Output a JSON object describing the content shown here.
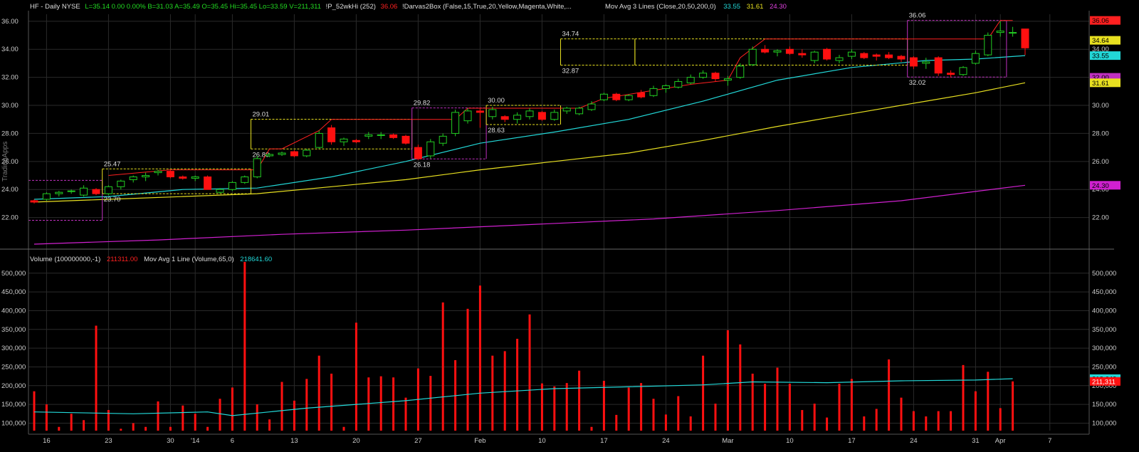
{
  "header": {
    "symbol_line": "HF - Daily  NYSE",
    "quote": "L=35.14  0.00  0.00%   B=31.03  A=35.49  O=35.45  Hi=35.45  Lo=33.59  V=211,311",
    "indicator_52wk": "!P_52wkHi (252)",
    "indicator_52wk_value": "36.06",
    "darvas": "!Darvas2Box (False,15,True,20,Yellow,Magenta,White,...",
    "mov_avg_label": "Mov Avg 3 Lines (Close,20,50,200,0)",
    "ma20_value": "33.55",
    "ma50_value": "31.61",
    "ma200_value": "24.30"
  },
  "volume_header": {
    "label": "Volume (100000000,-1)",
    "value": "211311.00",
    "ma_label": "Mov Avg 1 Line (Volume,65,0)",
    "ma_value": "218641.60"
  },
  "watermark": "TradingApps",
  "colors": {
    "up": "#22cc22",
    "down": "#ff1010",
    "ma20": "#22d8d8",
    "ma50": "#e8e020",
    "ma200": "#d020d0",
    "box_yellow": "#e8e020",
    "box_magenta": "#c030c0",
    "hi52": "#ff2020",
    "volume_bar": "#ff1010",
    "volume_ma": "#22d8d8"
  },
  "price_axis": {
    "ticks": [
      "36.00",
      "34.00",
      "32.00",
      "30.00",
      "28.00",
      "26.00",
      "24.00",
      "22.00"
    ],
    "tick_values": [
      36,
      34,
      32,
      30,
      28,
      26,
      24,
      22
    ],
    "ylim": [
      20,
      36.5
    ]
  },
  "volume_axis": {
    "ticks": [
      "500,000",
      "450,000",
      "400,000",
      "350,000",
      "300,000",
      "250,000",
      "200,000",
      "150,000",
      "100,000"
    ],
    "tick_values": [
      500000,
      450000,
      400000,
      350000,
      300000,
      250000,
      200000,
      150000,
      100000
    ],
    "ylim": [
      80000,
      530000
    ]
  },
  "x_axis": {
    "labels": [
      "16",
      "23",
      "30",
      "'14",
      "6",
      "13",
      "20",
      "27",
      "Feb",
      "10",
      "17",
      "24",
      "Mar",
      "10",
      "17",
      "24",
      "31",
      "Apr",
      "7"
    ],
    "label_slots": [
      1,
      6,
      11,
      13,
      16,
      21,
      26,
      31,
      36,
      41,
      46,
      51,
      56,
      61,
      66,
      71,
      76,
      78,
      82
    ]
  },
  "price_tags": [
    {
      "label": "36.06",
      "value": 36.06,
      "bg": "#ff2020",
      "fg": "#000"
    },
    {
      "label": "34.64",
      "value": 34.64,
      "bg": "#e8e020",
      "fg": "#000"
    },
    {
      "label": "33.55",
      "value": 33.55,
      "bg": "#22d8d8",
      "fg": "#000"
    },
    {
      "label": "32.00",
      "value": 32.0,
      "bg": "#c030c0",
      "fg": "#000"
    },
    {
      "label": "31.61",
      "value": 31.61,
      "bg": "#e8e020",
      "fg": "#000"
    },
    {
      "label": "24.30",
      "value": 24.3,
      "bg": "#d020d0",
      "fg": "#000"
    }
  ],
  "volume_tags": [
    {
      "label": "218,642",
      "value": 218642,
      "bg": "#22d8d8",
      "fg": "#000"
    },
    {
      "label": "211,311",
      "value": 211311,
      "bg": "#ff1010",
      "fg": "#fff"
    }
  ],
  "chart_data": {
    "type": "candlestick",
    "slot_unit": "trading day index (0 = first visible bar)",
    "candles": [
      {
        "i": 0,
        "o": 23.2,
        "h": 23.3,
        "l": 23.0,
        "c": 23.1
      },
      {
        "i": 1,
        "o": 23.3,
        "h": 23.8,
        "l": 23.2,
        "c": 23.7
      },
      {
        "i": 2,
        "o": 23.7,
        "h": 23.9,
        "l": 23.5,
        "c": 23.8
      },
      {
        "i": 3,
        "o": 23.9,
        "h": 24.0,
        "l": 23.7,
        "c": 23.9
      },
      {
        "i": 4,
        "o": 23.6,
        "h": 24.3,
        "l": 23.5,
        "c": 24.1
      },
      {
        "i": 5,
        "o": 24.0,
        "h": 24.1,
        "l": 23.6,
        "c": 23.7
      },
      {
        "i": 6,
        "o": 23.7,
        "h": 24.3,
        "l": 23.6,
        "c": 24.2
      },
      {
        "i": 7,
        "o": 24.2,
        "h": 24.7,
        "l": 24.0,
        "c": 24.6
      },
      {
        "i": 8,
        "o": 24.7,
        "h": 25.0,
        "l": 24.5,
        "c": 24.9
      },
      {
        "i": 9,
        "o": 24.9,
        "h": 25.2,
        "l": 24.6,
        "c": 25.0
      },
      {
        "i": 10,
        "o": 25.2,
        "h": 25.4,
        "l": 25.0,
        "c": 25.3
      },
      {
        "i": 11,
        "o": 25.3,
        "h": 25.4,
        "l": 24.8,
        "c": 24.9
      },
      {
        "i": 12,
        "o": 24.9,
        "h": 25.0,
        "l": 24.7,
        "c": 24.8
      },
      {
        "i": 13,
        "o": 24.8,
        "h": 25.0,
        "l": 24.6,
        "c": 24.9
      },
      {
        "i": 14,
        "o": 24.9,
        "h": 25.0,
        "l": 24.0,
        "c": 24.0
      },
      {
        "i": 15,
        "o": 23.8,
        "h": 24.1,
        "l": 23.7,
        "c": 24.0
      },
      {
        "i": 16,
        "o": 24.0,
        "h": 24.6,
        "l": 23.9,
        "c": 24.5
      },
      {
        "i": 17,
        "o": 24.5,
        "h": 25.0,
        "l": 24.4,
        "c": 24.9
      },
      {
        "i": 18,
        "o": 24.9,
        "h": 26.4,
        "l": 24.8,
        "c": 26.2
      },
      {
        "i": 19,
        "o": 26.4,
        "h": 26.6,
        "l": 26.3,
        "c": 26.5
      },
      {
        "i": 20,
        "o": 26.5,
        "h": 26.7,
        "l": 26.4,
        "c": 26.6
      },
      {
        "i": 21,
        "o": 26.7,
        "h": 26.8,
        "l": 26.3,
        "c": 26.4
      },
      {
        "i": 22,
        "o": 26.4,
        "h": 26.9,
        "l": 26.3,
        "c": 26.8
      },
      {
        "i": 23,
        "o": 27.0,
        "h": 28.2,
        "l": 26.9,
        "c": 28.0
      },
      {
        "i": 24,
        "o": 28.4,
        "h": 28.6,
        "l": 27.2,
        "c": 27.4
      },
      {
        "i": 25,
        "o": 27.4,
        "h": 27.7,
        "l": 27.1,
        "c": 27.6
      },
      {
        "i": 26,
        "o": 27.5,
        "h": 27.6,
        "l": 27.3,
        "c": 27.4
      },
      {
        "i": 27,
        "o": 27.8,
        "h": 28.1,
        "l": 27.6,
        "c": 27.9
      },
      {
        "i": 28,
        "o": 27.9,
        "h": 28.1,
        "l": 27.6,
        "c": 27.9
      },
      {
        "i": 29,
        "o": 27.9,
        "h": 28.0,
        "l": 27.6,
        "c": 27.7
      },
      {
        "i": 30,
        "o": 27.8,
        "h": 27.9,
        "l": 27.2,
        "c": 27.3
      },
      {
        "i": 31,
        "o": 27.0,
        "h": 27.2,
        "l": 26.1,
        "c": 26.2
      },
      {
        "i": 32,
        "o": 26.4,
        "h": 27.6,
        "l": 26.2,
        "c": 27.4
      },
      {
        "i": 33,
        "o": 27.3,
        "h": 28.0,
        "l": 27.1,
        "c": 27.8
      },
      {
        "i": 34,
        "o": 28.0,
        "h": 29.7,
        "l": 27.8,
        "c": 29.5
      },
      {
        "i": 35,
        "o": 28.9,
        "h": 29.8,
        "l": 28.7,
        "c": 29.6
      },
      {
        "i": 36,
        "o": 29.6,
        "h": 29.8,
        "l": 28.4,
        "c": 29.5
      },
      {
        "i": 37,
        "o": 29.2,
        "h": 29.9,
        "l": 29.0,
        "c": 29.7
      },
      {
        "i": 38,
        "o": 29.2,
        "h": 29.3,
        "l": 28.8,
        "c": 29.0
      },
      {
        "i": 39,
        "o": 29.0,
        "h": 29.5,
        "l": 28.7,
        "c": 29.3
      },
      {
        "i": 40,
        "o": 29.2,
        "h": 29.8,
        "l": 29.0,
        "c": 29.6
      },
      {
        "i": 41,
        "o": 29.5,
        "h": 29.6,
        "l": 28.9,
        "c": 29.0
      },
      {
        "i": 42,
        "o": 29.0,
        "h": 29.7,
        "l": 28.9,
        "c": 29.5
      },
      {
        "i": 43,
        "o": 29.6,
        "h": 29.9,
        "l": 29.4,
        "c": 29.8
      },
      {
        "i": 44,
        "o": 29.4,
        "h": 29.9,
        "l": 29.3,
        "c": 29.8
      },
      {
        "i": 45,
        "o": 29.7,
        "h": 30.3,
        "l": 29.6,
        "c": 30.1
      },
      {
        "i": 46,
        "o": 30.4,
        "h": 30.9,
        "l": 30.3,
        "c": 30.8
      },
      {
        "i": 47,
        "o": 30.8,
        "h": 30.9,
        "l": 30.3,
        "c": 30.4
      },
      {
        "i": 48,
        "o": 30.4,
        "h": 30.8,
        "l": 30.3,
        "c": 30.7
      },
      {
        "i": 49,
        "o": 30.9,
        "h": 31.1,
        "l": 30.5,
        "c": 30.6
      },
      {
        "i": 50,
        "o": 30.7,
        "h": 31.4,
        "l": 30.6,
        "c": 31.2
      },
      {
        "i": 51,
        "o": 31.2,
        "h": 31.5,
        "l": 30.9,
        "c": 31.4
      },
      {
        "i": 52,
        "o": 31.3,
        "h": 31.9,
        "l": 31.2,
        "c": 31.7
      },
      {
        "i": 53,
        "o": 31.6,
        "h": 32.2,
        "l": 31.5,
        "c": 32.0
      },
      {
        "i": 54,
        "o": 32.0,
        "h": 32.5,
        "l": 31.9,
        "c": 32.3
      },
      {
        "i": 55,
        "o": 32.3,
        "h": 32.4,
        "l": 31.7,
        "c": 31.9
      },
      {
        "i": 56,
        "o": 31.8,
        "h": 32.1,
        "l": 31.4,
        "c": 31.9
      },
      {
        "i": 57,
        "o": 32.0,
        "h": 33.0,
        "l": 31.9,
        "c": 32.8
      },
      {
        "i": 58,
        "o": 32.9,
        "h": 34.2,
        "l": 32.8,
        "c": 34.0
      },
      {
        "i": 59,
        "o": 34.0,
        "h": 34.3,
        "l": 33.7,
        "c": 33.8
      },
      {
        "i": 60,
        "o": 33.8,
        "h": 34.0,
        "l": 33.5,
        "c": 33.9
      },
      {
        "i": 61,
        "o": 34.0,
        "h": 34.2,
        "l": 33.6,
        "c": 33.7
      },
      {
        "i": 62,
        "o": 33.7,
        "h": 34.0,
        "l": 33.4,
        "c": 33.6
      },
      {
        "i": 63,
        "o": 33.2,
        "h": 33.9,
        "l": 33.0,
        "c": 33.8
      },
      {
        "i": 64,
        "o": 34.0,
        "h": 34.1,
        "l": 33.2,
        "c": 33.3
      },
      {
        "i": 65,
        "o": 33.2,
        "h": 33.6,
        "l": 33.0,
        "c": 33.4
      },
      {
        "i": 66,
        "o": 33.5,
        "h": 34.0,
        "l": 33.3,
        "c": 33.8
      },
      {
        "i": 67,
        "o": 33.7,
        "h": 33.8,
        "l": 33.3,
        "c": 33.4
      },
      {
        "i": 68,
        "o": 33.6,
        "h": 33.7,
        "l": 33.2,
        "c": 33.5
      },
      {
        "i": 69,
        "o": 33.6,
        "h": 33.8,
        "l": 33.3,
        "c": 33.4
      },
      {
        "i": 70,
        "o": 33.5,
        "h": 33.6,
        "l": 33.1,
        "c": 33.3
      },
      {
        "i": 71,
        "o": 33.4,
        "h": 33.5,
        "l": 32.6,
        "c": 32.8
      },
      {
        "i": 72,
        "o": 33.0,
        "h": 33.4,
        "l": 32.6,
        "c": 33.1
      },
      {
        "i": 73,
        "o": 33.4,
        "h": 33.5,
        "l": 32.1,
        "c": 32.3
      },
      {
        "i": 74,
        "o": 32.3,
        "h": 32.5,
        "l": 32.0,
        "c": 32.2
      },
      {
        "i": 75,
        "o": 32.2,
        "h": 32.8,
        "l": 32.1,
        "c": 32.7
      },
      {
        "i": 76,
        "o": 33.0,
        "h": 33.9,
        "l": 32.9,
        "c": 33.7
      },
      {
        "i": 77,
        "o": 33.6,
        "h": 35.2,
        "l": 33.5,
        "c": 35.0
      },
      {
        "i": 78,
        "o": 35.2,
        "h": 36.0,
        "l": 34.9,
        "c": 35.3
      },
      {
        "i": 79,
        "o": 35.2,
        "h": 35.6,
        "l": 34.9,
        "c": 35.2
      },
      {
        "i": 80,
        "o": 35.45,
        "h": 35.45,
        "l": 33.59,
        "c": 34.1
      }
    ],
    "ma20": [
      [
        0,
        23.3
      ],
      [
        6,
        23.5
      ],
      [
        12,
        24.0
      ],
      [
        18,
        24.1
      ],
      [
        24,
        24.9
      ],
      [
        30,
        26.0
      ],
      [
        36,
        27.3
      ],
      [
        42,
        28.1
      ],
      [
        48,
        29.0
      ],
      [
        54,
        30.3
      ],
      [
        60,
        31.8
      ],
      [
        66,
        32.7
      ],
      [
        72,
        33.2
      ],
      [
        76,
        33.3
      ],
      [
        80,
        33.55
      ]
    ],
    "ma50": [
      [
        0,
        23.1
      ],
      [
        6,
        23.3
      ],
      [
        12,
        23.5
      ],
      [
        18,
        23.7
      ],
      [
        24,
        24.2
      ],
      [
        30,
        24.7
      ],
      [
        36,
        25.4
      ],
      [
        42,
        26.0
      ],
      [
        48,
        26.6
      ],
      [
        54,
        27.5
      ],
      [
        60,
        28.5
      ],
      [
        66,
        29.4
      ],
      [
        72,
        30.3
      ],
      [
        76,
        30.9
      ],
      [
        80,
        31.61
      ]
    ],
    "ma200": [
      [
        0,
        20.1
      ],
      [
        10,
        20.4
      ],
      [
        20,
        20.8
      ],
      [
        30,
        21.1
      ],
      [
        40,
        21.5
      ],
      [
        50,
        21.9
      ],
      [
        60,
        22.5
      ],
      [
        70,
        23.2
      ],
      [
        80,
        24.3
      ]
    ],
    "hi52_line": [
      [
        6,
        25.0
      ],
      [
        11,
        25.4
      ],
      [
        18,
        25.4
      ],
      [
        19,
        26.9
      ],
      [
        20,
        26.9
      ],
      [
        23,
        28.2
      ],
      [
        24,
        29.0
      ],
      [
        34,
        29.0
      ],
      [
        35,
        29.8
      ],
      [
        44,
        29.8
      ],
      [
        46,
        30.5
      ],
      [
        53,
        31.5
      ],
      [
        56,
        31.8
      ],
      [
        57,
        33.4
      ],
      [
        59,
        34.74
      ],
      [
        77,
        34.74
      ],
      [
        78,
        36.06
      ],
      [
        79,
        36.06
      ]
    ],
    "darvas_boxes": [
      {
        "x0": -2,
        "x1": 6,
        "top": 24.65,
        "bottom": 21.8,
        "color": "magenta",
        "top_label": "",
        "bottom_label": ""
      },
      {
        "x0": 6,
        "x1": 18,
        "top": 25.47,
        "bottom": 23.7,
        "color": "yellow",
        "top_label": "25.47",
        "bottom_label": "23.70"
      },
      {
        "x0": 18,
        "x1": 31,
        "top": 29.01,
        "bottom": 26.89,
        "color": "yellow",
        "top_label": "29.01",
        "bottom_label": "26.89"
      },
      {
        "x0": 31,
        "x1": 37,
        "top": 29.82,
        "bottom": 26.18,
        "color": "magenta",
        "top_label": "29.82",
        "bottom_label": "26.18"
      },
      {
        "x0": 37,
        "x1": 43,
        "top": 30.0,
        "bottom": 28.63,
        "color": "yellow",
        "top_label": "30.00",
        "bottom_label": "28.63"
      },
      {
        "x0": 43,
        "x1": 49,
        "top": 34.74,
        "bottom": 32.87,
        "color": "yellow",
        "top_label": "34.74",
        "bottom_label": "32.87"
      },
      {
        "x0": 49,
        "x1": 71,
        "top": 34.74,
        "bottom": 32.87,
        "color": "yellow",
        "top_label": "",
        "bottom_label": ""
      },
      {
        "x0": 71,
        "x1": 79,
        "top": 36.06,
        "bottom": 32.02,
        "color": "magenta",
        "top_label": "36.06",
        "bottom_label": "32.02"
      }
    ],
    "volume": [
      185000,
      150000,
      90000,
      125000,
      108000,
      360000,
      135000,
      85000,
      100000,
      90000,
      158000,
      90000,
      147000,
      125000,
      90000,
      165000,
      195000,
      530000,
      150000,
      110000,
      210000,
      160000,
      218000,
      280000,
      232000,
      90000,
      368000,
      222000,
      225000,
      222000,
      168000,
      246000,
      226000,
      422000,
      268000,
      405000,
      467000,
      280000,
      292000,
      325000,
      390000,
      206000,
      198000,
      207000,
      240000,
      90000,
      213000,
      122000,
      195000,
      207000,
      165000,
      123000,
      172000,
      118000,
      280000,
      152000,
      348000,
      310000,
      232000,
      205000,
      248000,
      205000,
      135000,
      152000,
      115000,
      205000,
      218000,
      118000,
      138000,
      270000,
      168000,
      132000,
      118000,
      132000,
      132000,
      255000,
      185000,
      237000,
      140000,
      211311
    ],
    "volume_ma": [
      [
        0,
        130000
      ],
      [
        8,
        125000
      ],
      [
        14,
        130000
      ],
      [
        16,
        120000
      ],
      [
        22,
        140000
      ],
      [
        30,
        160000
      ],
      [
        36,
        180000
      ],
      [
        42,
        192000
      ],
      [
        48,
        197000
      ],
      [
        54,
        202000
      ],
      [
        58,
        210000
      ],
      [
        64,
        208000
      ],
      [
        70,
        213000
      ],
      [
        76,
        215000
      ],
      [
        79,
        218642
      ]
    ]
  }
}
